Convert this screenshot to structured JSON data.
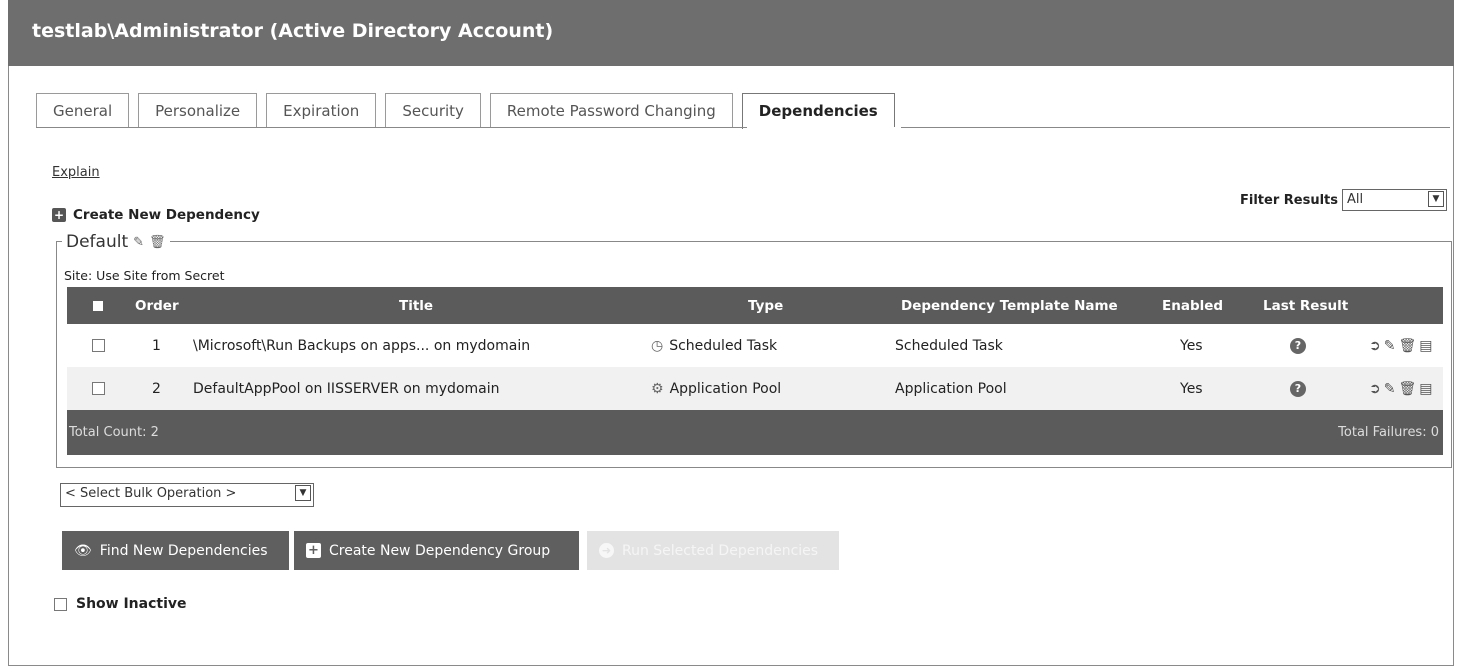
{
  "window": {
    "title": "testlab\\Administrator (Active Directory Account)"
  },
  "tabs": [
    {
      "label": "General",
      "active": false
    },
    {
      "label": "Personalize",
      "active": false
    },
    {
      "label": "Expiration",
      "active": false
    },
    {
      "label": "Security",
      "active": false
    },
    {
      "label": "Remote Password Changing",
      "active": false
    },
    {
      "label": "Dependencies",
      "active": true
    }
  ],
  "explain_link": "Explain",
  "create_new_dependency": "Create New Dependency",
  "filter": {
    "label": "Filter Results",
    "value": "All"
  },
  "group": {
    "name": "Default",
    "site": "Site: Use Site from Secret",
    "columns": {
      "order": "Order",
      "title": "Title",
      "type": "Type",
      "template": "Dependency Template Name",
      "enabled": "Enabled",
      "last_result": "Last Result"
    },
    "rows": [
      {
        "order": "1",
        "title": "\\Microsoft\\Run Backups on apps... on mydomain",
        "type": "Scheduled Task",
        "type_icon": "clock-icon",
        "template": "Scheduled Task",
        "enabled": "Yes",
        "last_result_icon": "question-icon"
      },
      {
        "order": "2",
        "title": "DefaultAppPool on IISSERVER on mydomain",
        "type": "Application Pool",
        "type_icon": "app-pool-icon",
        "template": "Application Pool",
        "enabled": "Yes",
        "last_result_icon": "question-icon"
      }
    ],
    "total_count": "Total Count: 2",
    "total_failures": "Total Failures: 0"
  },
  "bulk_operation": {
    "value": "< Select Bulk Operation >"
  },
  "buttons": {
    "find_new": "Find New Dependencies",
    "create_group": "Create New Dependency Group",
    "run_selected": "Run Selected Dependencies"
  },
  "show_inactive": "Show Inactive",
  "colors": {
    "header_bg": "#6e6e6e",
    "grid_header": "#5b5b5b",
    "alt_row": "#f1f1f1",
    "disabled_button": "#e3e3e3"
  }
}
